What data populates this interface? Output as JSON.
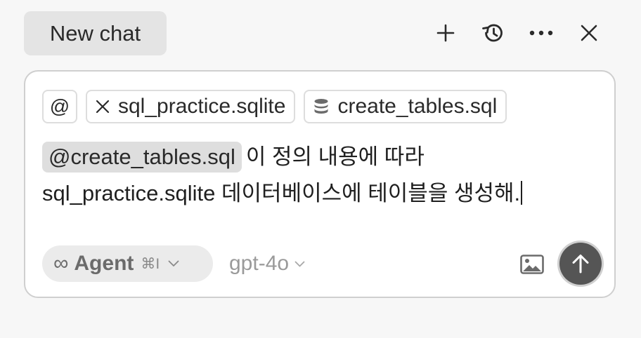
{
  "header": {
    "tab_label": "New chat",
    "icons": [
      "plus-icon",
      "history-icon",
      "more-icon",
      "close-icon"
    ]
  },
  "composer": {
    "chips": {
      "at_label": "@",
      "chip1_label": "sql_practice.sqlite",
      "chip1_icon": "close-icon",
      "chip2_label": "create_tables.sql",
      "chip2_icon": "database-icon"
    },
    "message": {
      "mention": "@create_tables.sql",
      "text": "이 정의 내용에 따라 sql_practice.sqlite 데이터베이스에 테이블을 생성해."
    },
    "mode": {
      "icon": "∞",
      "label": "Agent",
      "shortcut": "⌘I"
    },
    "model": "gpt-4o",
    "colors": {
      "send_button": "#555555",
      "mention_bg": "#dedede"
    }
  }
}
